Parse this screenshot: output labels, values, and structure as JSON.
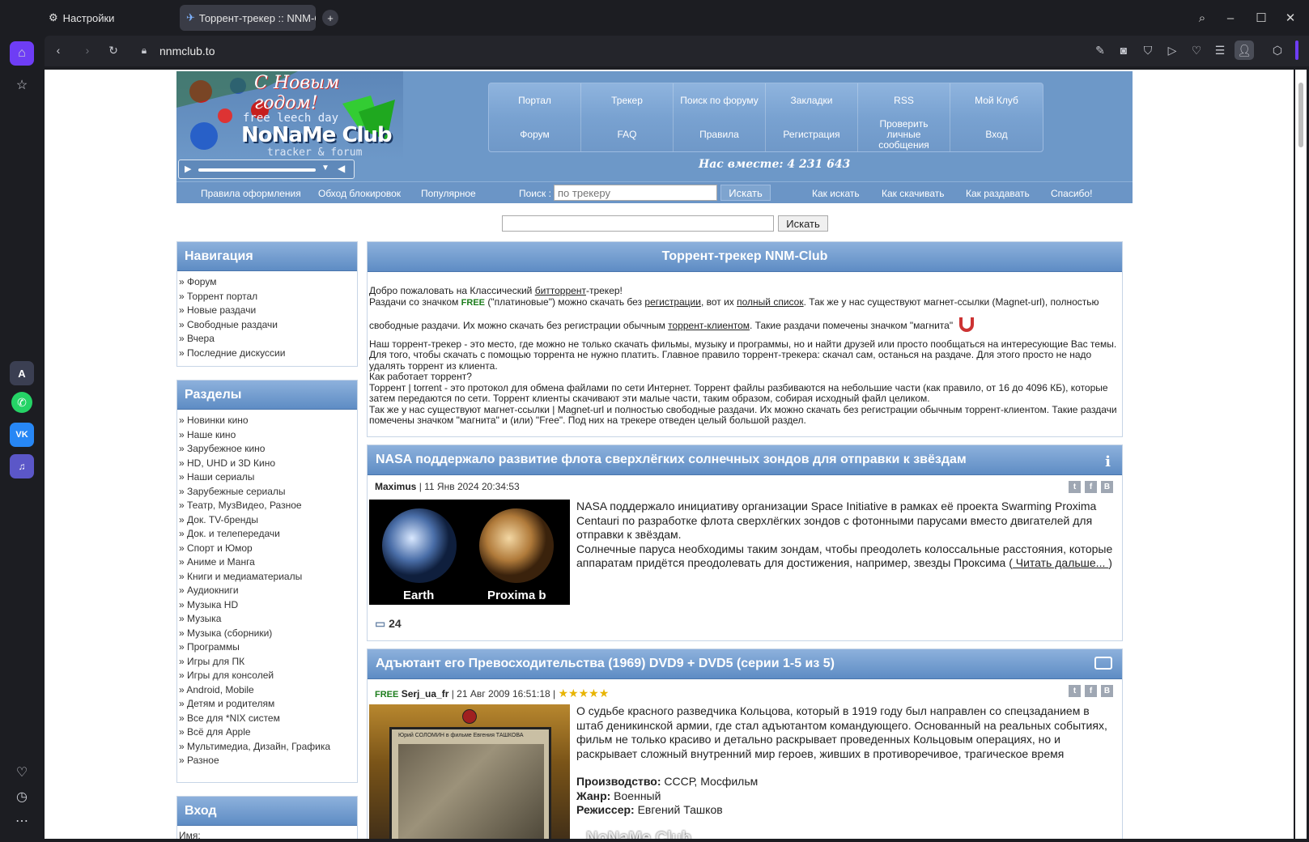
{
  "browser": {
    "tabs": [
      {
        "label": "Настройки"
      },
      {
        "label": "Торрент-трекер :: NNM-C"
      }
    ],
    "new_tab": "+",
    "url": "nnmclub.to"
  },
  "site": {
    "logo": {
      "greeting": "С Новым годом!",
      "tagline": "free leech day",
      "name": "NoNaMe Club",
      "subtitle": "tracker & forum"
    },
    "nav_top": [
      "Портал",
      "Трекер",
      "Поиск по форуму",
      "Закладки",
      "RSS",
      "Мой Клуб"
    ],
    "nav_bottom": [
      "Форум",
      "FAQ",
      "Правила",
      "Регистрация",
      "Проверить личные сообщения",
      "Вход"
    ],
    "together": "Нас вместе: 4 231 643",
    "subbar_left": [
      "Правила оформления",
      "Обход блокировок",
      "Популярное"
    ],
    "search_label": "Поиск :",
    "search_placeholder": "по трекеру",
    "search_button": "Искать",
    "subbar_right": [
      "Как искать",
      "Как скачивать",
      "Как раздавать",
      "Спасибо!"
    ],
    "second_search_button": "Искать"
  },
  "left": {
    "nav_title": "Навигация",
    "nav_items": [
      "» Форум",
      "» Торрент портал",
      "» Новые раздачи",
      "» Свободные раздачи",
      "» Вчера",
      "» Последние дискуссии"
    ],
    "sections_title": "Разделы",
    "sections": [
      "» Новинки кино",
      "» Наше кино",
      "» Зарубежное кино",
      "» HD, UHD и 3D Кино",
      "» Наши сериалы",
      "» Зарубежные сериалы",
      "» Театр, МузВидео, Разное",
      "» Док. TV-бренды",
      "» Док. и телепередачи",
      "» Спорт и Юмор",
      "» Аниме и Манга",
      "» Книги и медиаматериалы",
      "» Аудиокниги",
      "» Музыка HD",
      "» Музыка",
      "» Музыка (сборники)",
      "» Программы",
      "» Игры для ПК",
      "» Игры для консолей",
      "» Android, Mobile",
      "» Детям и родителям",
      "» Все для *NIX систем",
      "» Всё для Apple",
      "» Мультимедиа, Дизайн, Графика",
      "» Разное"
    ],
    "login_title": "Вход",
    "login_name": "Имя:"
  },
  "intro": {
    "title": "Торрент-трекер NNM-Club",
    "l1a": "Добро пожаловать на Классический ",
    "l1link": "битторрент",
    "l1b": "-трекер!",
    "l2a": "Раздачи со значком ",
    "free": "FREE",
    "l2b": " (\"платиновые\") можно скачать без ",
    "l2link1": "регистрации",
    "l2c": ", вот их ",
    "l2link2": "полный список",
    "l2d": ". Так же у нас существуют магнет-ссылки (Magnet-url), полностью",
    "l3a": "свободные раздачи. Их можно скачать без регистрации обычным ",
    "l3link": "торрент-клиентом",
    "l3b": ". Такие раздачи помечены значком \"магнита\"",
    "p2": "Наш торрент-трекер - это место, где можно не только скачать фильмы, музыку и программы, но и найти друзей или просто пообщаться на интересующие Вас темы. Для того, чтобы скачать с помощью торрента не нужно платить. Главное правило торрент-трекера: скачал сам, останься на раздаче. Для этого просто не надо удалять торрент из клиента.",
    "p3": "Как работает торрент?",
    "p4": "Торрент | torrent - это протокол для обмена файлами по сети Интернет. Торрент файлы разбиваются на небольшие части (как правило, от 16 до 4096 КБ), которые затем передаются по сети. Торрент клиенты скачивают эти малые части, таким образом, собирая исходный файл целиком.",
    "p5": "Так же у нас существуют магнет-ссылки | Magnet-url и полностью свободные раздачи. Их можно скачать без регистрации обычным торрент-клиентом. Такие раздачи помечены значком \"магнита\" и (или) \"Free\". Под них на трекере отведен целый большой раздел."
  },
  "post1": {
    "title": "NASA поддержало развитие флота сверхлёгких солнечных зондов для отправки к звёздам",
    "author": "Maximus",
    "date": " | 11 Янв 2024 20:34:53",
    "img_left": "Earth",
    "img_right": "Proxima b",
    "text1": "NASA поддержало инициативу организации Space Initiative в рамках её проекта Swarming Proxima Centauri по разработке флота сверхлёгких зондов с фотонными парусами вместо двигателей для отправки к звёздам.",
    "text2": "Солнечные паруса необходимы таким зондам, чтобы преодолеть колоссальные расстояния, которые аппаратам придётся преодолевать для достижения, например, звезды Проксима (",
    "read_more": " Читать дальше... ",
    "text2_end": ")",
    "comments": "24"
  },
  "post2": {
    "title": "Адъютант его Превосходительства (1969) DVD9 + DVD5 (серии 1-5 из 5)",
    "free": "FREE",
    "author": "Serj_ua_fr",
    "date": " | 21 Авг 2009 16:51:18 |",
    "stars": "★★★★★",
    "poster_text": "Юрий СОЛОМИН в фильме Евгения ТАШКОВА",
    "text1": "О судьбе красного разведчика Кольцова, который в 1919 году был направлен со спецзаданием в штаб деникинской армии, где стал адъютантом командующего. Основанный на реальных событиях, фильм не только красиво и детально раскрывает проведенных Кольцовым операциях, но и раскрывает сложный внутренний мир героев, живших в противоречивое, трагическое время",
    "production_label": "Производство:",
    "production": " СССР, Мосфильм",
    "genre_label": "Жанр:",
    "genre": " Военный",
    "director_label": "Режиссер:",
    "director": " Евгений Ташков",
    "watermark": "NoNaMe Club"
  },
  "colors": {
    "accent": "#6d98c8",
    "header_grad_top": "#8db1dc",
    "header_grad_bottom": "#5e8cc4"
  }
}
